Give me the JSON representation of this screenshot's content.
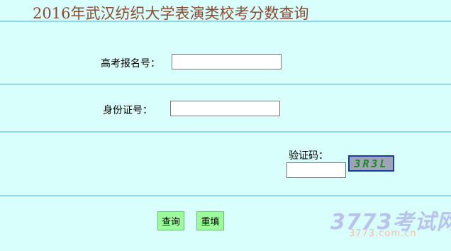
{
  "page": {
    "title": "2016年武汉纺织大学表演类校考分数查询"
  },
  "form": {
    "exam_number_label": "高考报名号：",
    "exam_number_value": "",
    "id_number_label": "身份证号：",
    "id_number_value": "",
    "captcha_label": "验证码：",
    "captcha_value": "",
    "captcha_image_text": "3R3L"
  },
  "buttons": {
    "query_label": "查询",
    "reset_label": "重填"
  },
  "watermark": {
    "brand": "3773考试网",
    "url": "3773.com.cn"
  },
  "colors": {
    "background": "#d9fffd",
    "title": "#8a4a32",
    "divider": "#8fd9ef",
    "button": "#9aff9a",
    "captcha_text": "#1f8a2a",
    "captcha_border": "#1a3c9a"
  }
}
